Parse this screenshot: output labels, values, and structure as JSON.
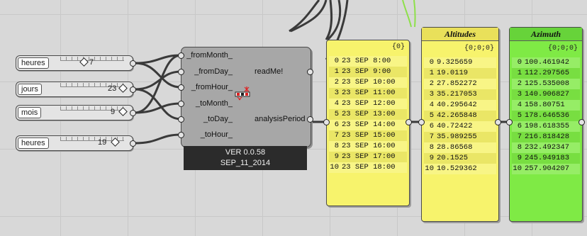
{
  "sliders": [
    {
      "label": "heures",
      "value": "7"
    },
    {
      "label": "jours",
      "value": "23"
    },
    {
      "label": "mois",
      "value": "9"
    },
    {
      "label": "heures",
      "value": "19"
    }
  ],
  "component": {
    "inputs": [
      "_fromMonth_",
      "_fromDay_",
      "_fromHour_",
      "_toMonth_",
      "_toDay_",
      "_toHour_"
    ],
    "outputs": [
      "readMe!",
      "analysisPeriod"
    ],
    "version": "VER 0.0.58",
    "date": "SEP_11_2014",
    "icon": "analysis-period-icon"
  },
  "panels": [
    {
      "title": "",
      "path": "{0}",
      "rows": [
        "23 SEP 8:00",
        "23 SEP 9:00",
        "23 SEP 10:00",
        "23 SEP 11:00",
        "23 SEP 12:00",
        "23 SEP 13:00",
        "23 SEP 14:00",
        "23 SEP 15:00",
        "23 SEP 16:00",
        "23 SEP 17:00",
        "23 SEP 18:00"
      ],
      "color": "#f7f36c"
    },
    {
      "title": "Altitudes",
      "path": "{0;0;0}",
      "rows": [
        "9.325659",
        "19.0119",
        "27.852272",
        "35.217053",
        "40.295642",
        "42.265848",
        "40.72422",
        "35.989255",
        "28.86568",
        "20.1525",
        "10.529362"
      ],
      "color": "#f7f36c"
    },
    {
      "title": "Azimuth",
      "path": "{0;0;0}",
      "rows": [
        "100.461942",
        "112.297565",
        "125.535008",
        "140.906827",
        "158.80751",
        "178.646536",
        "198.618355",
        "216.818428",
        "232.492347",
        "245.949183",
        "257.904207"
      ],
      "color": "#7fea45"
    }
  ],
  "colors": {
    "wire": "#3a3a3a",
    "selected_wire": "#8ee04a",
    "panel_yellow": "#f7f36c",
    "panel_green": "#7fea45"
  }
}
